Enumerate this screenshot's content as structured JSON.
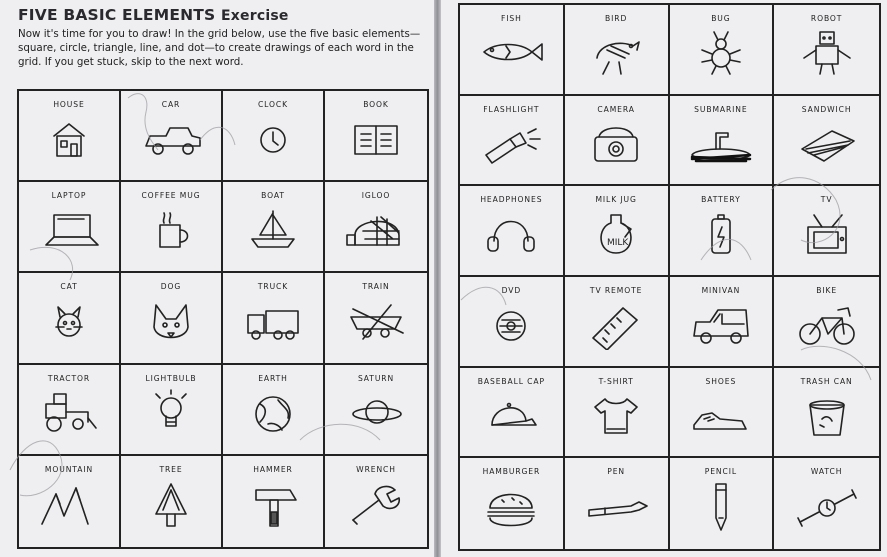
{
  "header": {
    "title": "FIVE BASIC ELEMENTS",
    "title_suffix": "Exercise",
    "instructions": "Now it's time for you to draw! In the grid below, use the five basic elements—square, circle, triangle, line, and dot—to create drawings of each word in the grid. If you get stuck, skip to the next word."
  },
  "left_grid": {
    "words": [
      "HOUSE",
      "CAR",
      "CLOCK",
      "BOOK",
      "LAPTOP",
      "COFFEE MUG",
      "BOAT",
      "IGLOO",
      "CAT",
      "DOG",
      "TRUCK",
      "TRAIN",
      "TRACTOR",
      "LIGHTBULB",
      "EARTH",
      "SATURN",
      "MOUNTAIN",
      "TREE",
      "HAMMER",
      "WRENCH"
    ]
  },
  "right_grid": {
    "words": [
      "FISH",
      "BIRD",
      "BUG",
      "ROBOT",
      "FLASHLIGHT",
      "CAMERA",
      "SUBMARINE",
      "SANDWICH",
      "HEADPHONES",
      "MILK JUG",
      "BATTERY",
      "TV",
      "DVD",
      "TV REMOTE",
      "MINIVAN",
      "BIKE",
      "BASEBALL CAP",
      "T-SHIRT",
      "SHOES",
      "TRASH CAN",
      "HAMBURGER",
      "PEN",
      "PENCIL",
      "WATCH"
    ]
  },
  "handwritten": {
    "milk_label": "MILK"
  },
  "colors": {
    "paper": "#efeff1",
    "ink": "#222222",
    "gutter": "#8f8f96"
  }
}
